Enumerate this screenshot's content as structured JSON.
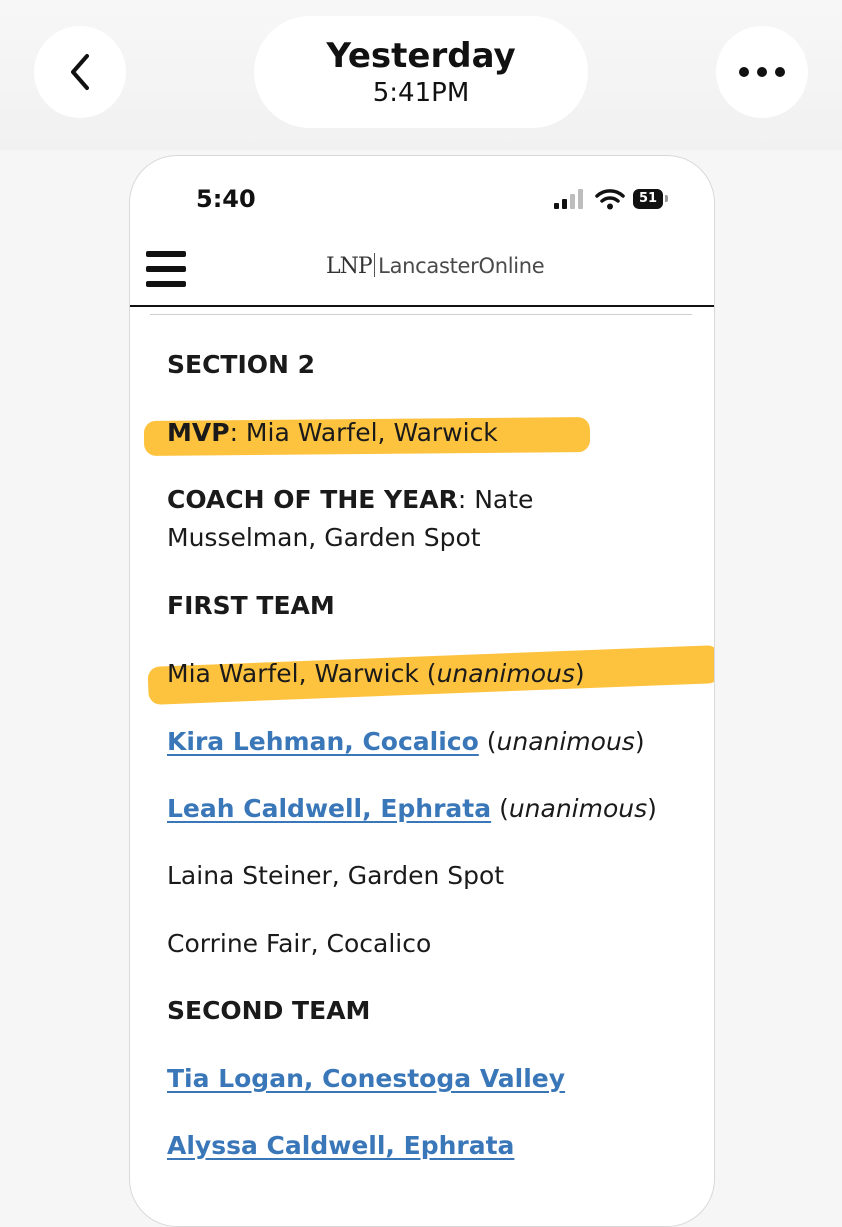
{
  "message_header": {
    "date": "Yesterday",
    "time": "5:41PM"
  },
  "phone": {
    "status_time": "5:40",
    "battery_level": "51"
  },
  "site": {
    "logo_left": "LNP",
    "logo_right": "LancasterOnline"
  },
  "article": {
    "section_title": "SECTION 2",
    "mvp_label": "MVP",
    "mvp_value": ": Mia Warfel, Warwick",
    "coach_label": "COACH OF THE YEAR",
    "coach_value_1": ": Nate",
    "coach_value_2": "Musselman, Garden Spot",
    "first_team_title": "FIRST TEAM",
    "first_team": [
      {
        "name": "Mia Warfel, Warwick",
        "open": " (",
        "note": "unanimous",
        "close": ")"
      },
      {
        "name": "Kira Lehman, Cocalico",
        "open": " (",
        "note": "unanimous",
        "close": ")"
      },
      {
        "name": "Leah Caldwell, Ephrata",
        "open": " (",
        "note": "unanimous",
        "close": ")"
      },
      {
        "name": "Laina Steiner, Garden Spot"
      },
      {
        "name": "Corrine Fair, Cocalico"
      }
    ],
    "second_team_title": "SECOND TEAM",
    "second_team": [
      {
        "name": "Tia Logan, Conestoga Valley "
      },
      {
        "name": "Alyssa Caldwell, Ephrata "
      }
    ]
  },
  "colors": {
    "link": "#3a77b9",
    "highlight": "#fdbd2a"
  }
}
